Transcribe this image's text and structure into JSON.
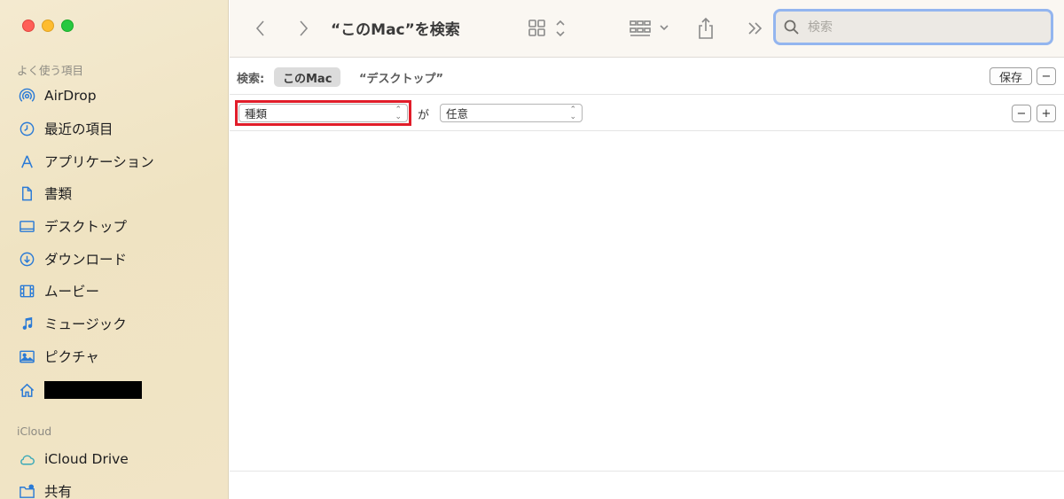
{
  "sidebar": {
    "favorites_label": "よく使う項目",
    "items": [
      {
        "label": "AirDrop",
        "icon": "airdrop-icon"
      },
      {
        "label": "最近の項目",
        "icon": "clock-icon"
      },
      {
        "label": "アプリケーション",
        "icon": "applications-icon"
      },
      {
        "label": "書類",
        "icon": "document-icon"
      },
      {
        "label": "デスクトップ",
        "icon": "desktop-icon"
      },
      {
        "label": "ダウンロード",
        "icon": "download-icon"
      },
      {
        "label": "ムービー",
        "icon": "film-icon"
      },
      {
        "label": "ミュージック",
        "icon": "music-note-icon"
      },
      {
        "label": "ピクチャ",
        "icon": "photo-icon"
      },
      {
        "label": "",
        "icon": "home-icon"
      }
    ],
    "icloud_label": "iCloud",
    "icloud_items": [
      {
        "label": "iCloud Drive",
        "icon": "cloud-icon"
      },
      {
        "label": "共有",
        "icon": "shared-folder-icon"
      }
    ]
  },
  "toolbar": {
    "title": "“このMac”を検索",
    "search_placeholder": "検索"
  },
  "scope_bar": {
    "label": "検索:",
    "active_scope": "このMac",
    "other_scope": "“デスクトップ”",
    "save_label": "保存",
    "remove_label": "−"
  },
  "criteria": {
    "attribute": "種類",
    "connector": "が",
    "value": "任意",
    "remove_label": "−",
    "add_label": "+"
  },
  "colors": {
    "accent": "#2a7ad6",
    "highlight": "#e11d2a",
    "search_focus": "#93b5ef"
  }
}
